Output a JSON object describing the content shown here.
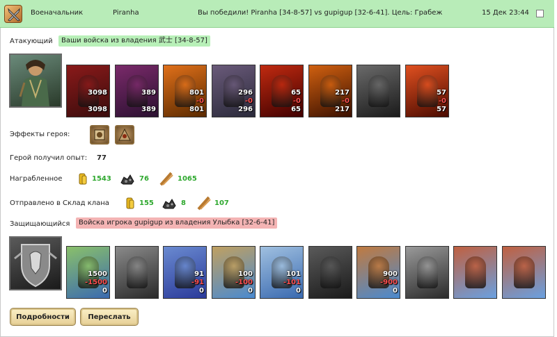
{
  "header": {
    "role": "Военачальник",
    "name": "Piranha",
    "message": "Вы победили! Piranha [34-8-57] vs gupigup [32-6-41]. Цель: Грабеж",
    "date": "15 Дек 23:44"
  },
  "attacker": {
    "label": "Атакующий",
    "tag": "Ваши войска из владения 武士 [34-8-57]",
    "units": [
      {
        "start": "3098",
        "loss": "",
        "end": "3098",
        "palette": [
          "#3a0c0c",
          "#8a1a1a"
        ]
      },
      {
        "start": "389",
        "loss": "",
        "end": "389",
        "palette": [
          "#2a1030",
          "#7a2a6a"
        ]
      },
      {
        "start": "801",
        "loss": "-0",
        "end": "801",
        "palette": [
          "#5a2a00",
          "#e0701a"
        ]
      },
      {
        "start": "296",
        "loss": "-0",
        "end": "296",
        "palette": [
          "#2a2a3a",
          "#6a5a7a"
        ]
      },
      {
        "start": "65",
        "loss": "-0",
        "end": "65",
        "palette": [
          "#400000",
          "#c02a10"
        ]
      },
      {
        "start": "217",
        "loss": "-0",
        "end": "217",
        "palette": [
          "#3a1000",
          "#d06010"
        ]
      },
      {
        "start": "",
        "loss": "",
        "end": "",
        "palette": [
          "#1a1a1a",
          "#6a6a6a"
        ]
      },
      {
        "start": "57",
        "loss": "-0",
        "end": "57",
        "palette": [
          "#4a0a00",
          "#e05020"
        ]
      }
    ]
  },
  "hero_effects": {
    "label": "Эффекты героя:"
  },
  "experience": {
    "label": "Герой получил опыт:",
    "value": "77"
  },
  "loot": {
    "label": "Награбленное",
    "gold": "1543",
    "ore": "76",
    "wood": "1065"
  },
  "clan": {
    "label": "Отправлено в Склад клана",
    "gold": "155",
    "ore": "8",
    "wood": "107"
  },
  "defender": {
    "label": "Защищающийся",
    "tag": "Войска игрока gupigup из владения Улыбка [32-6-41]",
    "units": [
      {
        "start": "1500",
        "loss": "-1500",
        "end": "0",
        "palette": [
          "#3a6ab0",
          "#8ac06a"
        ]
      },
      {
        "start": "",
        "loss": "",
        "end": "",
        "palette": [
          "#2a2a2a",
          "#8a8a8a"
        ]
      },
      {
        "start": "91",
        "loss": "-91",
        "end": "0",
        "palette": [
          "#2a3a9a",
          "#6a8ad0"
        ]
      },
      {
        "start": "100",
        "loss": "-100",
        "end": "0",
        "palette": [
          "#4a8ad0",
          "#c0a060"
        ]
      },
      {
        "start": "101",
        "loss": "-101",
        "end": "0",
        "palette": [
          "#3a6ab0",
          "#a0c0e0"
        ]
      },
      {
        "start": "",
        "loss": "",
        "end": "",
        "palette": [
          "#1a1a1a",
          "#5a5a5a"
        ]
      },
      {
        "start": "900",
        "loss": "-900",
        "end": "0",
        "palette": [
          "#4a8ad0",
          "#c07a40"
        ]
      },
      {
        "start": "",
        "loss": "",
        "end": "",
        "palette": [
          "#2a2a2a",
          "#9a9a9a"
        ]
      },
      {
        "start": "",
        "loss": "",
        "end": "",
        "palette": [
          "#6aa0e0",
          "#c06040"
        ]
      },
      {
        "start": "",
        "loss": "",
        "end": "",
        "palette": [
          "#6aa0e0",
          "#c06040"
        ]
      }
    ]
  },
  "buttons": {
    "details": "Подробности",
    "forward": "Переслать"
  },
  "colors": {
    "header_bg": "#b8ecb8",
    "gain": "#2ea82e",
    "loss": "#ff5050",
    "attacker_tag": "#b8f0b8",
    "defender_tag": "#f4b4b4"
  }
}
